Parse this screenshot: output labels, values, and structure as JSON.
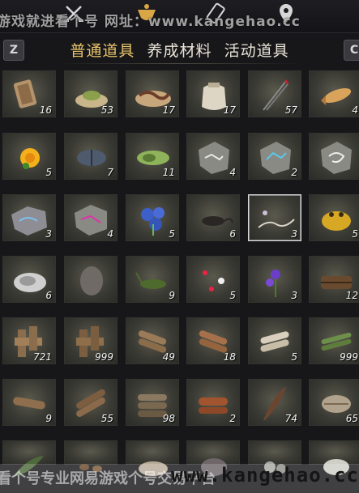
{
  "watermark": {
    "top": "游戏就进看个号  网址：www.kangehao.cc",
    "bottom": "看个号专业网易游戏个号交易平台",
    "url": "www.kangehao.cc"
  },
  "keys": {
    "left": "Z",
    "right": "C"
  },
  "tabs": [
    {
      "label": "普通道具",
      "active": true
    },
    {
      "label": "养成材料",
      "active": false
    },
    {
      "label": "活动道具",
      "active": false
    }
  ],
  "items": [
    {
      "icon": "cloth-scroll-icon",
      "qty": "16"
    },
    {
      "icon": "powder-pile-icon",
      "qty": "53"
    },
    {
      "icon": "worm-icon",
      "qty": "17"
    },
    {
      "icon": "sack-icon",
      "qty": "17"
    },
    {
      "icon": "arrow-icon",
      "qty": "57"
    },
    {
      "icon": "fish-icon",
      "qty": "4"
    },
    {
      "icon": "yellow-flower-icon",
      "qty": "5"
    },
    {
      "icon": "beetle-icon",
      "qty": "7"
    },
    {
      "icon": "cicada-icon",
      "qty": "11"
    },
    {
      "icon": "ore-white-icon",
      "qty": "4"
    },
    {
      "icon": "ore-blue-icon",
      "qty": "2"
    },
    {
      "icon": "ore-scorpion-icon",
      "qty": ""
    },
    {
      "icon": "ore-purple-icon",
      "qty": "3"
    },
    {
      "icon": "ore-red-icon",
      "qty": "4"
    },
    {
      "icon": "blue-flower-icon",
      "qty": "5"
    },
    {
      "icon": "rat-icon",
      "qty": "6"
    },
    {
      "icon": "root-icon",
      "qty": "3"
    },
    {
      "icon": "toad-icon",
      "qty": "5"
    },
    {
      "icon": "shell-icon",
      "qty": "6"
    },
    {
      "icon": "stone-icon",
      "qty": ""
    },
    {
      "icon": "grasshopper-icon",
      "qty": "9"
    },
    {
      "icon": "fireflies-icon",
      "qty": "5"
    },
    {
      "icon": "purple-herb-icon",
      "qty": "3"
    },
    {
      "icon": "basket-icon",
      "qty": "12"
    },
    {
      "icon": "cross-block-icon",
      "qty": "721"
    },
    {
      "icon": "cross-block-dark-icon",
      "qty": "999"
    },
    {
      "icon": "logs-icon",
      "qty": "49"
    },
    {
      "icon": "logs-brown-icon",
      "qty": "18"
    },
    {
      "icon": "logs-pale-icon",
      "qty": "5"
    },
    {
      "icon": "bamboo-icon",
      "qty": "999"
    },
    {
      "icon": "log-pair-icon",
      "qty": "9"
    },
    {
      "icon": "log-bundle-icon",
      "qty": "55"
    },
    {
      "icon": "log-stack-icon",
      "qty": "98"
    },
    {
      "icon": "log-red-icon",
      "qty": "2"
    },
    {
      "icon": "feather-icon",
      "qty": "74"
    },
    {
      "icon": "clam-icon",
      "qty": "65"
    },
    {
      "icon": "leaf-icon",
      "qty": ""
    },
    {
      "icon": "seeds-icon",
      "qty": ""
    },
    {
      "icon": "shell-pile-icon",
      "qty": ""
    },
    {
      "icon": "shell-grey-icon",
      "qty": ""
    },
    {
      "icon": "pebbles-icon",
      "qty": ""
    },
    {
      "icon": "shell-white-icon",
      "qty": ""
    }
  ],
  "selected_index": 16,
  "colors": {
    "active_tab": "#e8c36b",
    "tab": "#e9e4d6",
    "accent_gold": "#d9a646"
  }
}
